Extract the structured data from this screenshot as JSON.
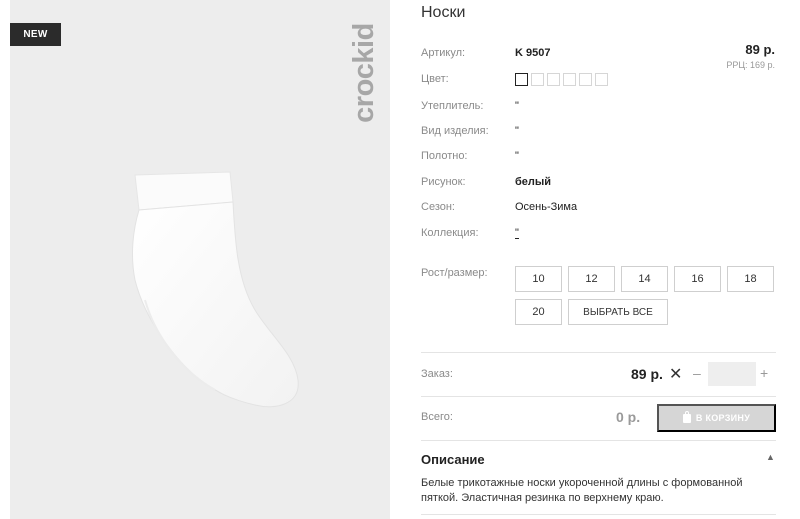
{
  "product": {
    "badge": "NEW",
    "brand": "crockid",
    "title": "Носки"
  },
  "attributes": [
    {
      "label": "Артикул:",
      "value": "K 9507"
    },
    {
      "label": "Цвет:",
      "value": ""
    },
    {
      "label": "Утеплитель:",
      "value": "\""
    },
    {
      "label": "Вид изделия:",
      "value": "\""
    },
    {
      "label": "Полотно:",
      "value": "\""
    },
    {
      "label": "Рисунок:",
      "value": "белый"
    },
    {
      "label": "Сезон:",
      "value": "Осень-Зима"
    },
    {
      "label": "Коллекция:",
      "value": "\""
    }
  ],
  "price": {
    "value": "89 р.",
    "rrp": "РРЦ: 169 р."
  },
  "colors": [
    "#ffffff",
    "#ffffff",
    "#ffffff",
    "#ffffff",
    "#ffffff",
    "#ffffff"
  ],
  "sizes": {
    "label": "Рост/размер:",
    "options": [
      "10",
      "12",
      "14",
      "16",
      "18",
      "20"
    ],
    "select_all": "ВЫБРАТЬ ВСЕ"
  },
  "order": {
    "label": "Заказ:",
    "price": "89 р.",
    "times": "✕",
    "minus": "–",
    "plus": "+",
    "quantity": ""
  },
  "total": {
    "label": "Всего:",
    "value": "0 р.",
    "cart_label": "В КОРЗИНУ"
  },
  "description": {
    "title": "Описание",
    "text": "Белые трикотажные носки укороченной длины с формованной пяткой. Эластичная резинка по верхнему краю."
  }
}
